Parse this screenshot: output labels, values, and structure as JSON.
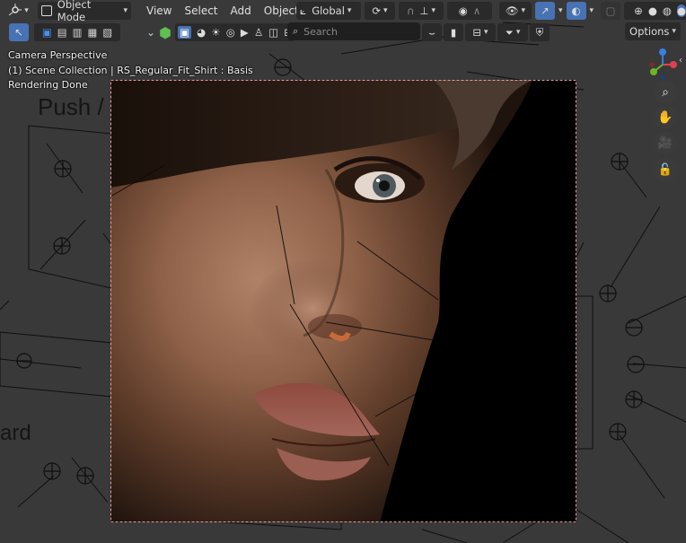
{
  "header": {
    "mode_label": "Object Mode",
    "menus": [
      "View",
      "Select",
      "Add",
      "Object"
    ],
    "orientation_label": "Global",
    "options_label": "Options",
    "search_placeholder": "Search"
  },
  "overlay": {
    "line1": "Camera Perspective",
    "line2": "(1) Scene Collection | RS_Regular_Fit_Shirt : Basis",
    "line3": "Rendering Done"
  },
  "background_labels": {
    "push_top": "Push /",
    "ward": "ard",
    "pu": "Pu"
  },
  "colors": {
    "viewport_bg": "#393939",
    "header_bg": "#303030",
    "accent_blue": "#4772b3",
    "gizmo_x": "#e0404f",
    "gizmo_y": "#6fb42a",
    "gizmo_z": "#3b7de0",
    "camera_frame": "#e49a9a"
  },
  "icons": {
    "editor_type": "editor-type-icon",
    "object_mode": "object-mode-icon",
    "zoom": "zoom-icon",
    "pan": "hand-icon",
    "camera_view": "camera-icon",
    "lock": "lock-icon"
  }
}
